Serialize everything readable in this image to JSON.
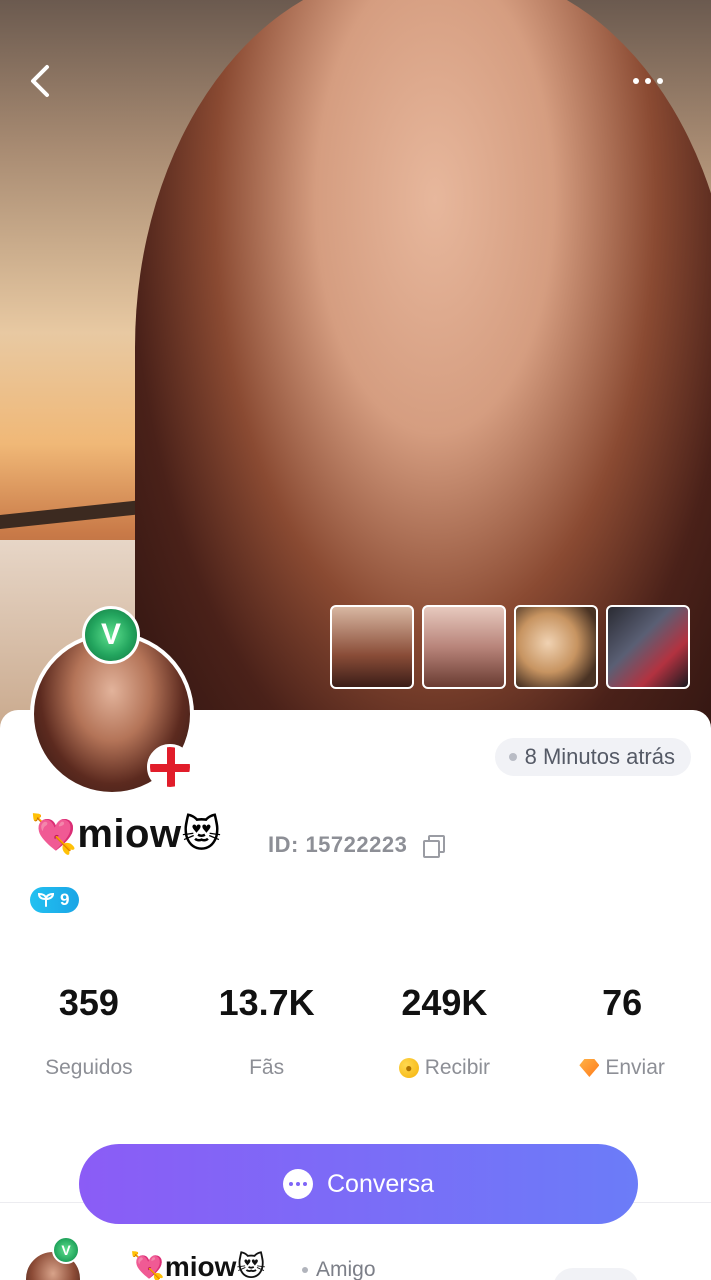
{
  "header": {
    "back_icon": "chevron-left-icon",
    "more_icon": "more-horizontal-icon"
  },
  "profile": {
    "name_prefix_emoji": "💘",
    "name": "miow",
    "name_suffix_emoji": "😻",
    "id_text": "ID: 15722223",
    "last_seen": "8 Minutos atrás",
    "level": "9",
    "vip_letter": "V"
  },
  "stats": [
    {
      "value": "359",
      "label": "Seguidos"
    },
    {
      "value": "13.7K",
      "label": "Fãs"
    },
    {
      "value": "249K",
      "label": "Recibir"
    },
    {
      "value": "76",
      "label": "Enviar"
    }
  ],
  "chat_button": {
    "label": "Conversa"
  },
  "post": {
    "name_prefix_emoji": "💘",
    "name": "miow",
    "name_suffix_emoji": "😻",
    "relation": "Amigo"
  },
  "colors": {
    "accent": "#7b6cf7",
    "vip_green": "#23a55e",
    "level_blue": "#22c1f1"
  }
}
